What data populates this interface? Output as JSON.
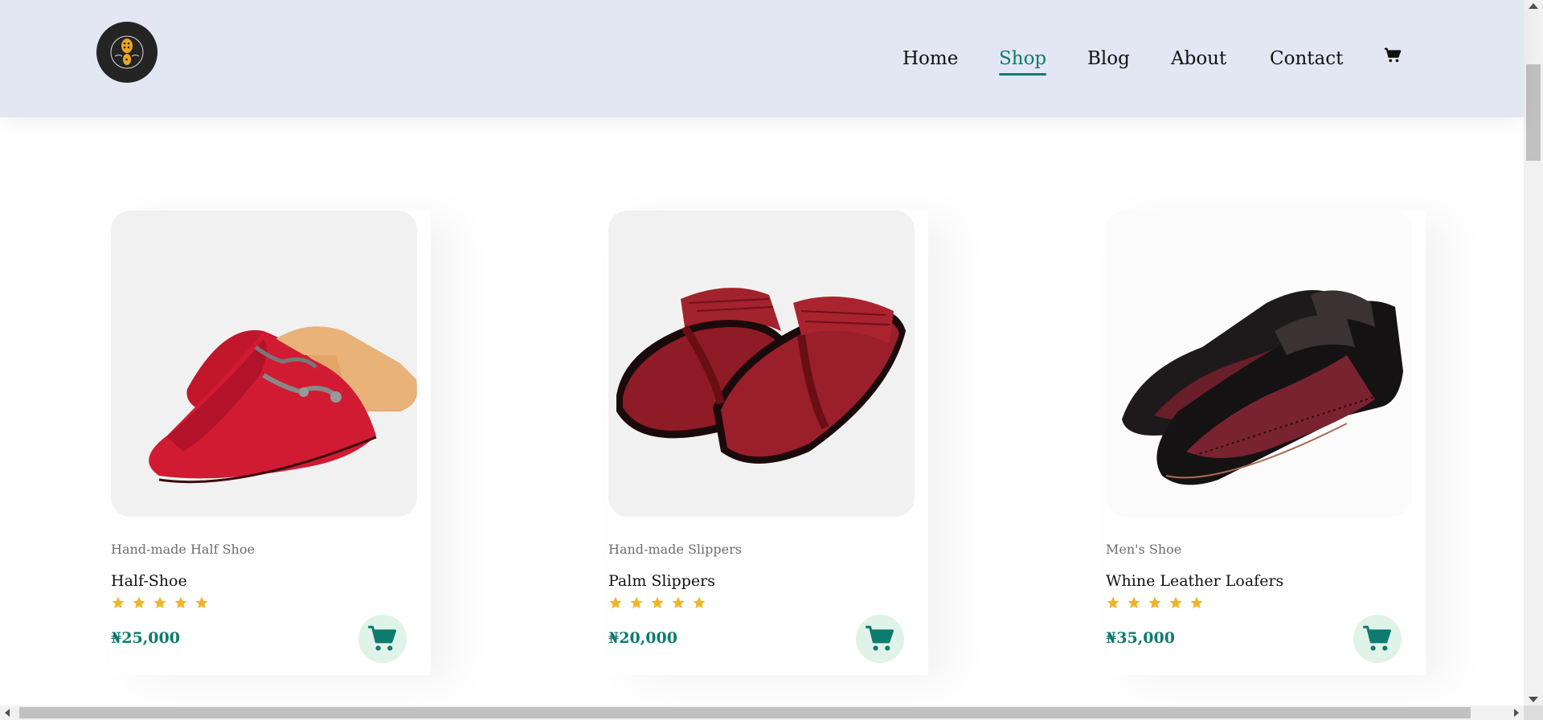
{
  "header": {
    "logo_icon": "boot-sole-logo-icon",
    "nav": [
      {
        "label": "Home",
        "active": false
      },
      {
        "label": "Shop",
        "active": true
      },
      {
        "label": "Blog",
        "active": false
      },
      {
        "label": "About",
        "active": false
      },
      {
        "label": "Contact",
        "active": false
      }
    ],
    "cart_icon": "cart-icon"
  },
  "products": [
    {
      "category": "Hand-made Half Shoe",
      "name": "Half-Shoe",
      "rating": 5,
      "price": "₦25,000",
      "image": "red-velvet-half-shoe"
    },
    {
      "category": "Hand-made Slippers",
      "name": "Palm Slippers",
      "rating": 5,
      "price": "₦20,000",
      "image": "maroon-palm-slippers"
    },
    {
      "category": "Men's Shoe",
      "name": "Whine Leather Loafers",
      "rating": 5,
      "price": "₦35,000",
      "image": "black-wine-leather-loafers"
    }
  ],
  "colors": {
    "header_bg": "#e3e7f3",
    "accent": "#0e7b6f",
    "star": "#f0b429",
    "cart_button_bg": "#e0f3e8"
  }
}
